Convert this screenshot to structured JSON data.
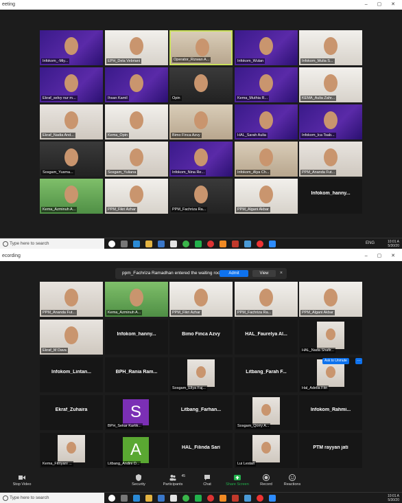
{
  "screen1": {
    "window_title": "eeting",
    "grid": [
      [
        {
          "name": "Infokom_-Miy...",
          "bg": "purple",
          "mic_icon": true
        },
        {
          "name": "EPH_Dela Vebriani",
          "bg": "wall"
        },
        {
          "name": "Operator_Rizwan A...",
          "bg": "beige",
          "active": true
        },
        {
          "name": "Infokom_Wulan",
          "bg": "purple"
        },
        {
          "name": "Infokom_Mulia S...",
          "bg": "wall"
        }
      ],
      [
        {
          "name": "Ekraf_selvy nur m...",
          "bg": "purple"
        },
        {
          "name": "Ihsan Kamil",
          "bg": "purple"
        },
        {
          "name": "Opin",
          "bg": "dark"
        },
        {
          "name": "Kema_Muthia R...",
          "bg": "purple"
        },
        {
          "name": "KEMA_Aulia Zahr...",
          "bg": "wall"
        }
      ],
      [
        {
          "name": "Ekraf_Nadia And...",
          "bg": "light"
        },
        {
          "name": "Kema_Opin",
          "bg": "wall"
        },
        {
          "name": "Bimo Finca Azvy",
          "bg": "beige"
        },
        {
          "name": "HAL_Sarah Aulia",
          "bg": "purple"
        },
        {
          "name": "Infokom_Ica Tsab...",
          "bg": "purple"
        }
      ],
      [
        {
          "name": "Sosgam_Yusma...",
          "bg": "dark"
        },
        {
          "name": "Sosgam_Yuliana",
          "bg": "light"
        },
        {
          "name": "Infokom_Nina Re...",
          "bg": "purple"
        },
        {
          "name": "Infokom_Alya Ch...",
          "bg": "beige"
        },
        {
          "name": "PPM_Ananda Fut...",
          "bg": "light"
        }
      ],
      [
        {
          "name": "Kema_Azminuh A...",
          "bg": "green"
        },
        {
          "name": "PPM_Fikri Azhar",
          "bg": "wall"
        },
        {
          "name": "PPM_Fachriza Ra...",
          "bg": "dark"
        },
        {
          "name": "PPM_Algani Akbar",
          "bg": "wall"
        },
        {
          "name": "Infokom_hanny...",
          "bg": "black",
          "video_off": true
        }
      ]
    ],
    "taskbar": {
      "search_placeholder": "Type here to search",
      "lang": "ENG",
      "time": "10:01 A",
      "date": "5/30/20"
    }
  },
  "screen2": {
    "window_title": "ecording",
    "toast": {
      "message": "ppm_Fachriza Ramadhan entered the waiting room",
      "admit_label": "Admit",
      "view_label": "View",
      "close_icon": "×"
    },
    "grid": [
      [
        {
          "name": "PPM_Ananda Fut...",
          "bg": "light"
        },
        {
          "name": "Kema_Azminuh A...",
          "bg": "green"
        },
        {
          "name": "PPM_Fikri Azhar",
          "bg": "wall"
        },
        {
          "name": "PPM_Fachriza Ra...",
          "bg": "wall"
        },
        {
          "name": "PPM_Algani Akbar",
          "bg": "wall"
        }
      ],
      [
        {
          "name": "Ekraf_M Dava",
          "bg": "light"
        },
        {
          "name": "Infokom_hanny...",
          "bg": "black",
          "video_off": true
        },
        {
          "name": "Bimo Finca Azvy",
          "bg": "black",
          "video_off": true
        },
        {
          "name": "HAL_Faurelya Al...",
          "bg": "black",
          "video_off": true
        },
        {
          "name": "HAL_Nada Shafir...",
          "bg": "black",
          "small_pic": true
        }
      ],
      [
        {
          "name": "Infokom_Lintan...",
          "bg": "black",
          "video_off": true
        },
        {
          "name": "BPH_Rania Ram...",
          "bg": "black",
          "video_off": true
        },
        {
          "name": "Sosgam_Ellya Faj...",
          "bg": "black",
          "small_pic": true
        },
        {
          "name": "Litbang_Farah F...",
          "bg": "black",
          "video_off": true
        },
        {
          "name": "Hal_Adelia Fitri",
          "bg": "black",
          "small_pic": true
        }
      ],
      [
        {
          "name": "Ekraf_Zuhaira",
          "bg": "black",
          "video_off": true
        },
        {
          "name": "BPH_Sekar Kartik...",
          "bg": "black",
          "avatar": "S",
          "avatar_color": "#7b2fb5"
        },
        {
          "name": "Litbang_Farhan...",
          "bg": "black",
          "video_off": true
        },
        {
          "name": "Sosgam_Qorry A...",
          "bg": "black",
          "small_pic": true
        },
        {
          "name": "Infokom_Rahmi...",
          "bg": "black",
          "video_off": true
        }
      ],
      [
        {
          "name": "Kema_Fitriyani ...",
          "bg": "black",
          "small_pic": true
        },
        {
          "name": "Litbang_Andini D...",
          "bg": "black",
          "avatar": "A",
          "avatar_color": "#5aa832"
        },
        {
          "name": "HAL_Filinda Sari",
          "bg": "black",
          "video_off": true
        },
        {
          "name": "Lui Lestari",
          "bg": "black",
          "small_pic": true
        },
        {
          "name": "PTM rayyan jati",
          "bg": "black",
          "video_off": true
        }
      ]
    ],
    "pin_tag": "Ask to Unmute",
    "controls": {
      "stop_video": "Stop Video",
      "security": "Security",
      "participants": "Participants",
      "participants_count": "45",
      "chat": "Chat",
      "share_screen": "Share Screen",
      "record": "Record",
      "reactions": "Reactions"
    },
    "taskbar": {
      "search_placeholder": "Type here to search",
      "time": "10:01 A",
      "date": "5/30/20"
    }
  },
  "colors": {
    "zoom_blue": "#0e72ed",
    "active_speaker": "#c9e05a",
    "share_green": "#22b14c"
  }
}
